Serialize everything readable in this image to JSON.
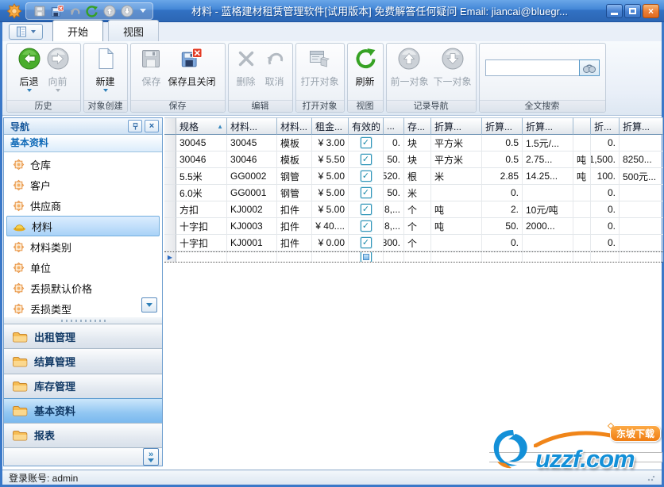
{
  "titlebar": {
    "title": "材料 - 蓝格建材租赁管理软件[试用版本] 免费解答任何疑问 Email: jiancai@bluegr..."
  },
  "glyphs": {
    "check": "✓",
    "sort_asc": "▲",
    "row_arrow": "▶",
    "close_x": "×",
    "more": "»"
  },
  "tabs": [
    {
      "label": "开始"
    },
    {
      "label": "视图"
    }
  ],
  "ribbon": {
    "history": {
      "label": "历史",
      "back": "后退",
      "forward": "向前"
    },
    "create": {
      "label": "对象创建",
      "new": "新建"
    },
    "save": {
      "label": "保存",
      "save": "保存",
      "save_close": "保存且关闭"
    },
    "edit": {
      "label": "编辑",
      "del": "删除",
      "cancel": "取消"
    },
    "open": {
      "label": "打开对象",
      "open_object": "打开对象"
    },
    "view": {
      "label": "视图",
      "refresh": "刷新"
    },
    "recnav": {
      "label": "记录导航",
      "prev": "前一对象",
      "next": "下一对象"
    },
    "search": {
      "label": "全文搜索",
      "value": ""
    }
  },
  "sidebar": {
    "title": "导航",
    "section": "基本资料",
    "items": [
      "仓库",
      "客户",
      "供应商",
      "材料",
      "材料类别",
      "单位",
      "丢损默认价格",
      "丢损类型"
    ],
    "selected_item": "材料",
    "groups": [
      "出租管理",
      "结算管理",
      "库存管理",
      "基本资料",
      "报表"
    ],
    "selected_group": "基本资料"
  },
  "table": {
    "columns": [
      "规格",
      "材料...",
      "材料...",
      "租金...",
      "有效的",
      "...",
      "存...",
      "折算...",
      "折算...",
      "折算...",
      "",
      "折...",
      "折算..."
    ],
    "sort_column": "规格",
    "rows": [
      {
        "valid": true,
        "cells": [
          "30045",
          "30045",
          "模板",
          "¥ 3.00",
          "0.",
          "块",
          "平方米",
          "0.5",
          "1.5元/...",
          "",
          "0.",
          ""
        ]
      },
      {
        "valid": true,
        "cells": [
          "30046",
          "30046",
          "模板",
          "¥ 5.50",
          "50.",
          "块",
          "平方米",
          "0.5",
          "2.75...",
          "吨",
          "1,500.",
          "8250..."
        ]
      },
      {
        "valid": true,
        "cells": [
          "5.5米",
          "GG0002",
          "钢管",
          "¥ 5.00",
          "520.",
          "根",
          "米",
          "2.85",
          "14.25...",
          "吨",
          "100.",
          "500元..."
        ]
      },
      {
        "valid": true,
        "cells": [
          "6.0米",
          "GG0001",
          "钢管",
          "¥ 5.00",
          "50.",
          "米",
          "",
          "0.",
          "",
          "",
          "0.",
          ""
        ]
      },
      {
        "valid": true,
        "cells": [
          "方扣",
          "KJ0002",
          "扣件",
          "¥ 5.00",
          "8,...",
          "个",
          "吨",
          "2.",
          "10元/吨",
          "",
          "0.",
          ""
        ]
      },
      {
        "valid": true,
        "cells": [
          "十字扣",
          "KJ0003",
          "扣件",
          "¥ 40....",
          "8,...",
          "个",
          "吨",
          "50.",
          "2000...",
          "",
          "0.",
          ""
        ]
      },
      {
        "valid": true,
        "cells": [
          "十字扣",
          "KJ0001",
          "扣件",
          "¥ 0.00",
          "800.",
          "个",
          "",
          "0.",
          "",
          "",
          "0.",
          ""
        ]
      }
    ]
  },
  "statusbar": {
    "login": "登录账号: admin"
  },
  "watermark": {
    "name": "uzzf",
    "domain": ".com",
    "badge": "东坡下载"
  },
  "icons": {
    "app": "orange-starburst",
    "save": "floppy-disk",
    "save_close": "floppy-red-x",
    "undo": "curved-arrow",
    "refresh": "green-circular-arrow",
    "back": "green-circle-left-arrow",
    "forward": "gray-circle-right-arrow",
    "prev": "gray-circle-up-arrow",
    "next": "gray-circle-down-arrow",
    "new": "blank-page",
    "delete": "gray-x",
    "open_object": "window-box",
    "search": "binoculars",
    "pin": "push-pin",
    "folder": "orange-folder",
    "material": "yellow-hard-hat",
    "nav_item": "orange-star"
  }
}
